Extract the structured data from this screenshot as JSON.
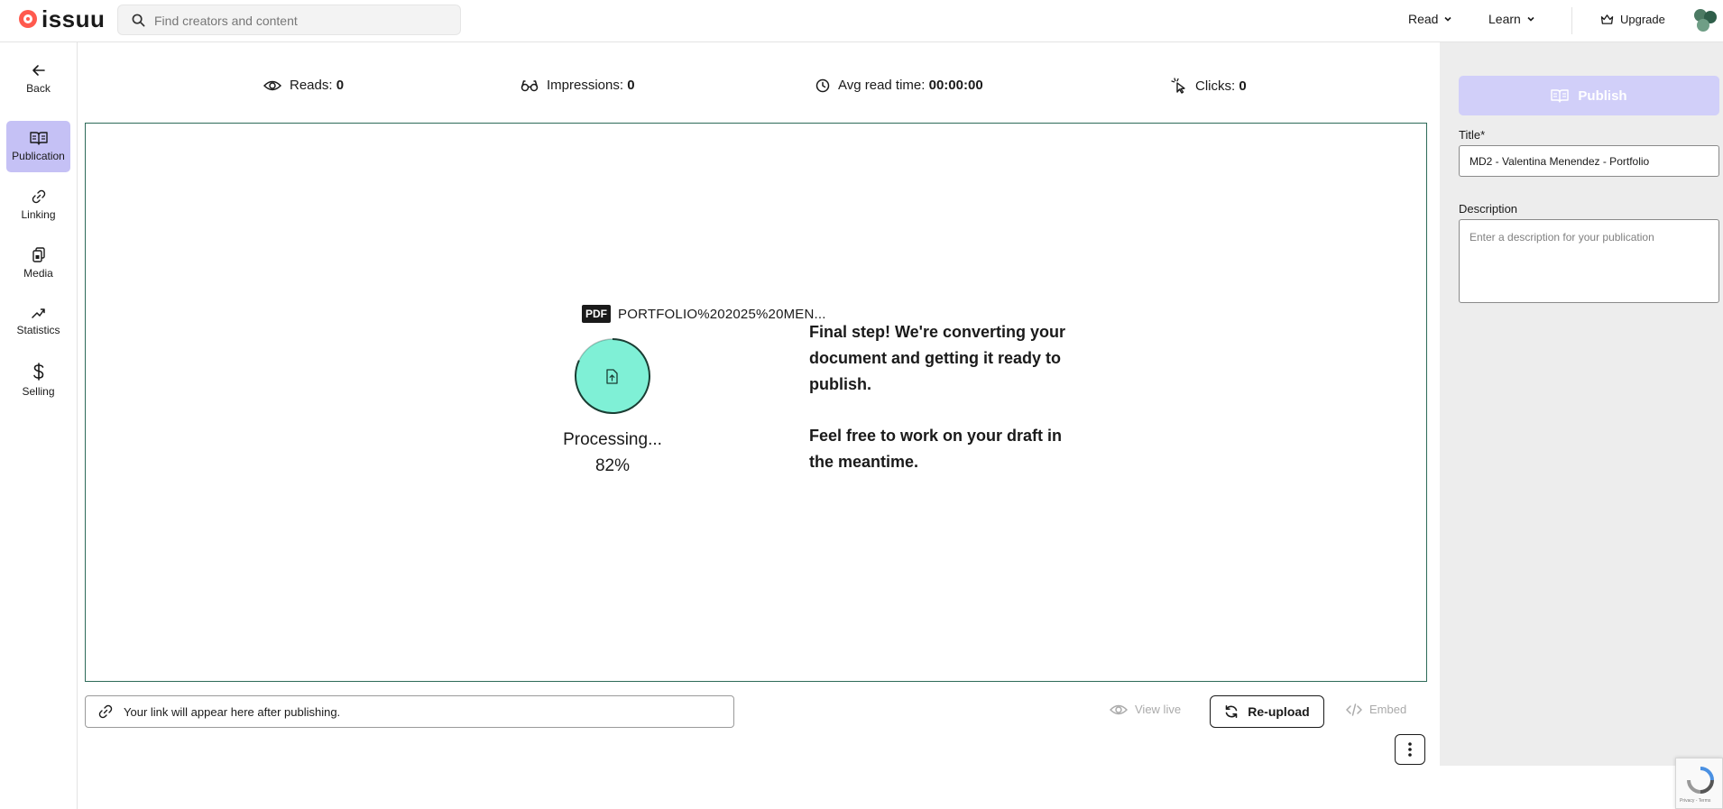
{
  "brand": {
    "name": "issuu"
  },
  "header": {
    "search_placeholder": "Find creators and content",
    "nav": [
      {
        "label": "Read"
      },
      {
        "label": "Learn"
      }
    ],
    "upgrade_label": "Upgrade"
  },
  "sidebar": {
    "back_label": "Back",
    "items": [
      {
        "label": "Publication",
        "icon": "book-open-icon",
        "active": true
      },
      {
        "label": "Linking",
        "icon": "link-icon",
        "active": false
      },
      {
        "label": "Media",
        "icon": "media-files-icon",
        "active": false
      },
      {
        "label": "Statistics",
        "icon": "trend-line-icon",
        "active": false
      },
      {
        "label": "Selling",
        "icon": "dollar-icon",
        "active": false
      }
    ]
  },
  "stats": {
    "reads_label": "Reads:",
    "reads_value": "0",
    "impressions_label": "Impressions:",
    "impressions_value": "0",
    "avg_label": "Avg read time:",
    "avg_value": "00:00:00",
    "clicks_label": "Clicks:",
    "clicks_value": "0"
  },
  "upload": {
    "badge": "PDF",
    "file_name": "PORTFOLIO%202025%20MEN...",
    "status": "Processing...",
    "percent": "82%",
    "progress_fraction": 0.82,
    "message_1": "Final step! We're converting your document and getting it ready to publish.",
    "message_2": "Feel free to work on your draft in the meantime."
  },
  "bottom_bar": {
    "link_placeholder": "Your link will appear here after publishing.",
    "view_live_label": "View live",
    "reupload_label": "Re-upload",
    "embed_label": "Embed"
  },
  "right_panel": {
    "publish_label": "Publish",
    "title_label": "Title*",
    "title_value": "MD2 - Valentina Menendez - Portfolio",
    "description_label": "Description",
    "description_placeholder": "Enter a description for your publication"
  },
  "recaptcha": {
    "text": "Privacy - Terms"
  },
  "colors": {
    "accent_lavender": "#c5c1f5",
    "publish_disabled": "#d1cff9",
    "progress_fill": "#7ff0d6",
    "panel_border": "#2d6a58",
    "brand_red": "#ff5a4e"
  }
}
